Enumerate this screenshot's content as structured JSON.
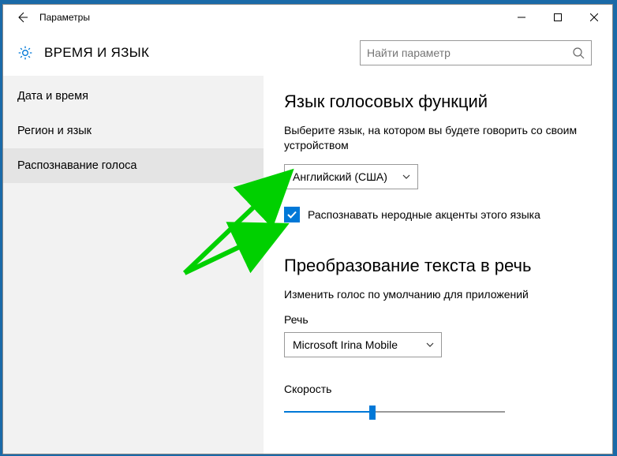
{
  "titlebar": {
    "title": "Параметры"
  },
  "header": {
    "title": "ВРЕМЯ И ЯЗЫК",
    "search_placeholder": "Найти параметр"
  },
  "sidebar": {
    "items": [
      {
        "label": "Дата и время"
      },
      {
        "label": "Регион и язык"
      },
      {
        "label": "Распознавание голоса"
      }
    ]
  },
  "main": {
    "section1_title": "Язык голосовых функций",
    "section1_desc": "Выберите язык, на котором вы будете говорить со своим устройством",
    "language_dropdown": "Английский (США)",
    "checkbox_label": "Распознавать неродные акценты этого языка",
    "section2_title": "Преобразование текста в речь",
    "section2_desc": "Изменить голос по умолчанию для приложений",
    "voice_label": "Речь",
    "voice_dropdown": "Microsoft Irina Mobile",
    "speed_label": "Скорость"
  }
}
